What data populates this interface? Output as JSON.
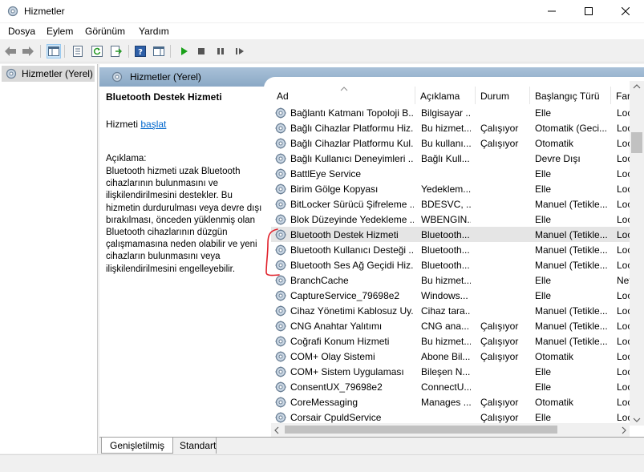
{
  "window": {
    "title": "Hizmetler"
  },
  "menu": [
    "Dosya",
    "Eylem",
    "Görünüm",
    "Yardım"
  ],
  "tree": {
    "item": "Hizmetler (Yerel)"
  },
  "panel": {
    "header": "Hizmetler (Yerel)"
  },
  "detail": {
    "service_name": "Bluetooth Destek Hizmeti",
    "action_prefix": "Hizmeti ",
    "action_link": "başlat",
    "desc_label": "Açıklama:",
    "desc_text": "Bluetooth hizmeti uzak Bluetooth cihazlarının bulunmasını ve ilişkilendirilmesini destekler. Bu hizmetin durdurulması veya devre dışı bırakılması, önceden yüklenmiş olan Bluetooth cihazlarının düzgün çalışmamasına neden olabilir ve yeni cihazların bulunmasını veya ilişkilendirilmesini engelleyebilir."
  },
  "columns": [
    "Ad",
    "Açıklama",
    "Durum",
    "Başlangıç Türü",
    "Far"
  ],
  "rows": [
    {
      "name": "Bağlantı Katmanı Topoloji B...",
      "desc": "Bilgisayar ...",
      "status": "",
      "start": "Elle",
      "logon": "Loc"
    },
    {
      "name": "Bağlı Cihazlar Platformu Hiz...",
      "desc": "Bu hizmet...",
      "status": "Çalışıyor",
      "start": "Otomatik (Geci...",
      "logon": "Loc"
    },
    {
      "name": "Bağlı Cihazlar Platformu Kul...",
      "desc": "Bu kullanı...",
      "status": "Çalışıyor",
      "start": "Otomatik",
      "logon": "Loc"
    },
    {
      "name": "Bağlı Kullanıcı Deneyimleri ...",
      "desc": "Bağlı Kull...",
      "status": "",
      "start": "Devre Dışı",
      "logon": "Loc"
    },
    {
      "name": "BattlEye Service",
      "desc": "",
      "status": "",
      "start": "Elle",
      "logon": "Loc"
    },
    {
      "name": "Birim Gölge Kopyası",
      "desc": "Yedeklem...",
      "status": "",
      "start": "Elle",
      "logon": "Loc"
    },
    {
      "name": "BitLocker Sürücü Şifreleme ...",
      "desc": "BDESVC, ...",
      "status": "",
      "start": "Manuel (Tetikle...",
      "logon": "Loc"
    },
    {
      "name": "Blok Düzeyinde Yedekleme ...",
      "desc": "WBENGIN...",
      "status": "",
      "start": "Elle",
      "logon": "Loc"
    },
    {
      "name": "Bluetooth Destek Hizmeti",
      "desc": "Bluetooth...",
      "status": "",
      "start": "Manuel (Tetikle...",
      "logon": "Loc"
    },
    {
      "name": "Bluetooth Kullanıcı Desteği ...",
      "desc": "Bluetooth...",
      "status": "",
      "start": "Manuel (Tetikle...",
      "logon": "Loc"
    },
    {
      "name": "Bluetooth Ses Ağ Geçidi Hiz...",
      "desc": "Bluetooth...",
      "status": "",
      "start": "Manuel (Tetikle...",
      "logon": "Loc"
    },
    {
      "name": "BranchCache",
      "desc": "Bu hizmet...",
      "status": "",
      "start": "Elle",
      "logon": "Net"
    },
    {
      "name": "CaptureService_79698e2",
      "desc": "Windows...",
      "status": "",
      "start": "Elle",
      "logon": "Loc"
    },
    {
      "name": "Cihaz Yönetimi Kablosuz Uy...",
      "desc": "Cihaz tara...",
      "status": "",
      "start": "Manuel (Tetikle...",
      "logon": "Loc"
    },
    {
      "name": "CNG Anahtar Yalıtımı",
      "desc": "CNG ana...",
      "status": "Çalışıyor",
      "start": "Manuel (Tetikle...",
      "logon": "Loc"
    },
    {
      "name": "Coğrafi Konum Hizmeti",
      "desc": "Bu hizmet...",
      "status": "Çalışıyor",
      "start": "Manuel (Tetikle...",
      "logon": "Loc"
    },
    {
      "name": "COM+ Olay Sistemi",
      "desc": "Abone Bil...",
      "status": "Çalışıyor",
      "start": "Otomatik",
      "logon": "Loc"
    },
    {
      "name": "COM+ Sistem Uygulaması",
      "desc": "Bileşen N...",
      "status": "",
      "start": "Elle",
      "logon": "Loc"
    },
    {
      "name": "ConsentUX_79698e2",
      "desc": "ConnectU...",
      "status": "",
      "start": "Elle",
      "logon": "Loc"
    },
    {
      "name": "CoreMessaging",
      "desc": "Manages ...",
      "status": "Çalışıyor",
      "start": "Otomatik",
      "logon": "Loc"
    },
    {
      "name": "Corsair CpuldService",
      "desc": "",
      "status": "Çalışıyor",
      "start": "Elle",
      "logon": "Loc"
    }
  ],
  "selected_row": 8,
  "tabs": [
    "Genişletilmiş",
    "Standart"
  ],
  "colors": {
    "header_band": "#9bb5cf",
    "link": "#0066cc",
    "annotation": "#e0202a",
    "play": "#1aa11a"
  }
}
